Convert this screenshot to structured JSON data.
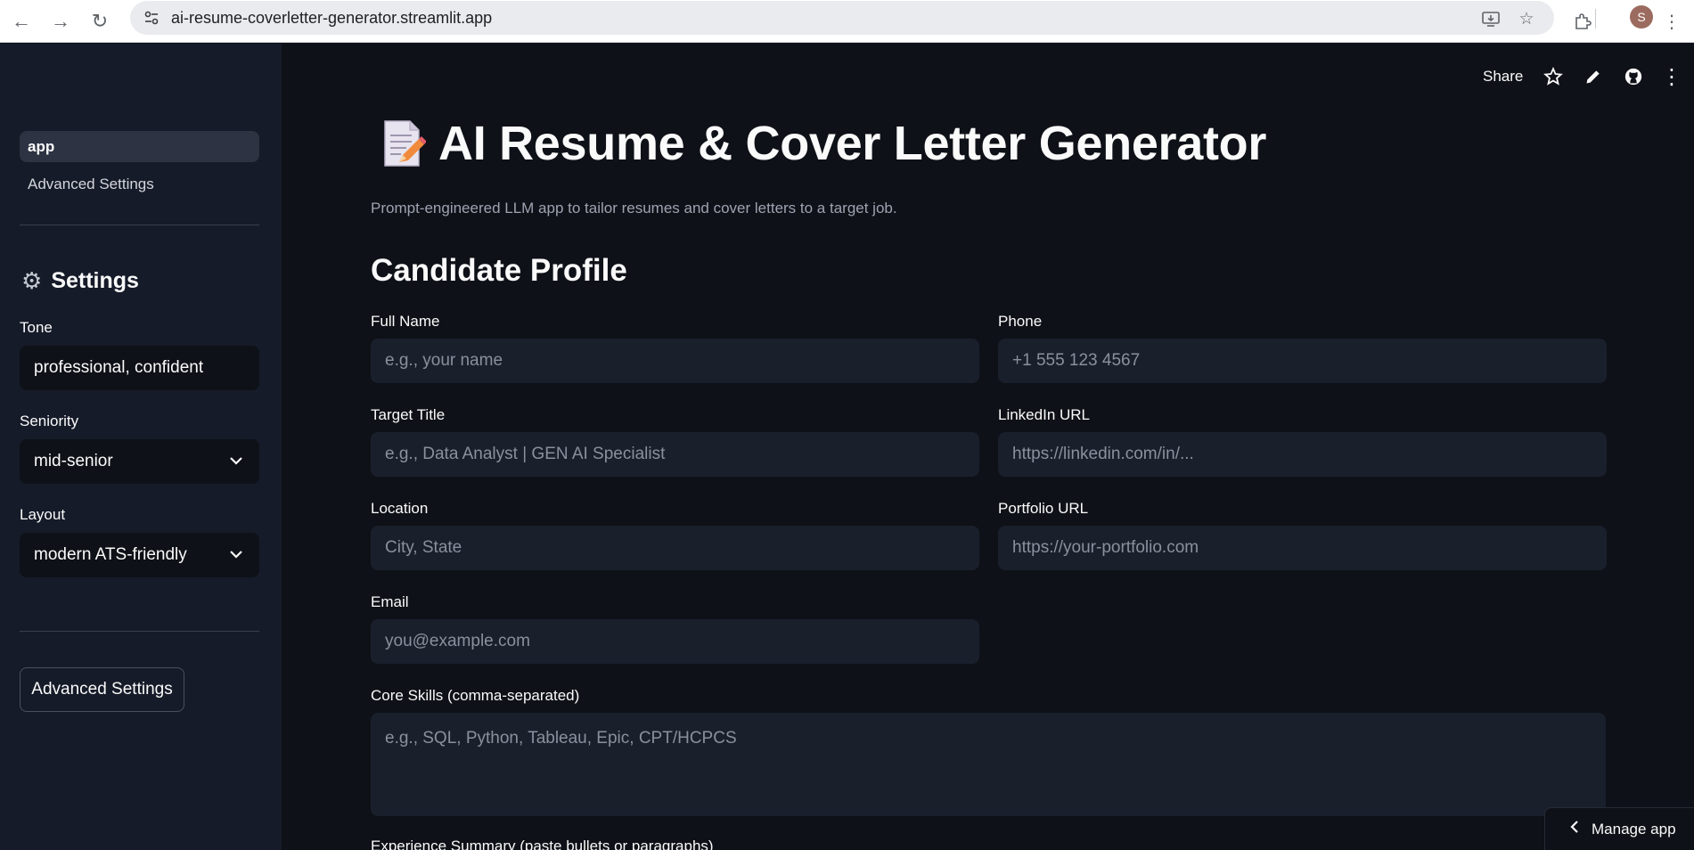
{
  "browser": {
    "url": "ai-resume-coverletter-generator.streamlit.app",
    "avatar_letter": "S"
  },
  "sidebar": {
    "nav": [
      {
        "label": "app",
        "active": true
      },
      {
        "label": "Advanced Settings",
        "active": false
      }
    ],
    "settings_title": "Settings",
    "tone": {
      "label": "Tone",
      "value": "professional, confident"
    },
    "seniority": {
      "label": "Seniority",
      "value": "mid-senior"
    },
    "layout": {
      "label": "Layout",
      "value": "modern ATS-friendly"
    },
    "advanced_button": "Advanced Settings"
  },
  "toolbar": {
    "share": "Share",
    "icons": [
      "star-icon",
      "pencil-icon",
      "github-icon",
      "more-vertical-icon"
    ]
  },
  "main": {
    "title": "AI Resume & Cover Letter Generator",
    "caption": "Prompt-engineered LLM app to tailor resumes and cover letters to a target job.",
    "section_title": "Candidate Profile",
    "fields": {
      "full_name": {
        "label": "Full Name",
        "placeholder": "e.g., your name"
      },
      "phone": {
        "label": "Phone",
        "placeholder": "+1 555 123 4567"
      },
      "target_title": {
        "label": "Target Title",
        "placeholder": "e.g., Data Analyst | GEN AI Specialist"
      },
      "linkedin": {
        "label": "LinkedIn URL",
        "placeholder": "https://linkedin.com/in/..."
      },
      "location": {
        "label": "Location",
        "placeholder": "City, State"
      },
      "portfolio": {
        "label": "Portfolio URL",
        "placeholder": "https://your-portfolio.com"
      },
      "email": {
        "label": "Email",
        "placeholder": "you@example.com"
      },
      "core_skills": {
        "label": "Core Skills (comma-separated)",
        "placeholder": "e.g., SQL, Python, Tableau, Epic, CPT/HCPCS"
      },
      "experience_summary": {
        "label": "Experience Summary (paste bullets or paragraphs)"
      }
    }
  },
  "manage_app": "Manage app",
  "colors": {
    "app_bg": "#0e1117",
    "sidebar_bg": "#161b29",
    "input_bg": "#1a1f2c"
  }
}
